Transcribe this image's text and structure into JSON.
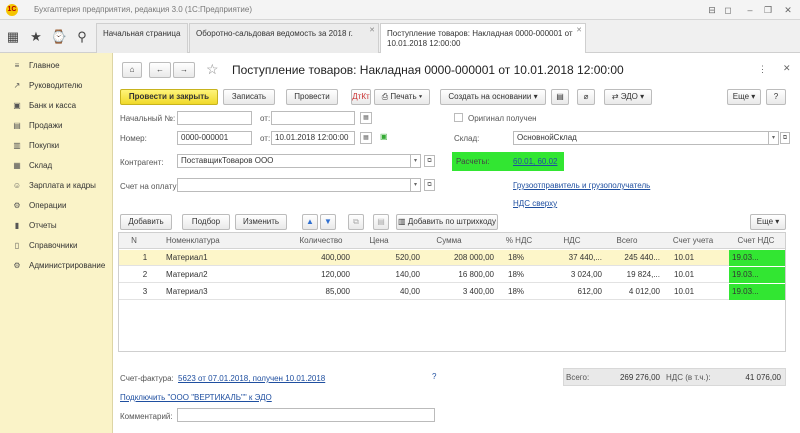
{
  "window": {
    "title": "Бухгалтерия предприятия, редакция 3.0 (1С:Предприятие)",
    "controls": [
      "⊟",
      "◻",
      "–",
      "❐",
      "✕"
    ]
  },
  "tabs": [
    {
      "label": "Начальная страница"
    },
    {
      "label": "Оборотно-сальдовая ведомость за 2018 г."
    },
    {
      "label": "Поступление товаров: Накладная 0000-000001 от 10.01.2018 12:00:00"
    }
  ],
  "sidebar": {
    "items": [
      {
        "icon": "≡",
        "label": "Главное"
      },
      {
        "icon": "↗",
        "label": "Руководителю"
      },
      {
        "icon": "▣",
        "label": "Банк и касса"
      },
      {
        "icon": "▤",
        "label": "Продажи"
      },
      {
        "icon": "▥",
        "label": "Покупки"
      },
      {
        "icon": "▦",
        "label": "Склад"
      },
      {
        "icon": "☺",
        "label": "Зарплата и кадры"
      },
      {
        "icon": "⚙",
        "label": "Операции"
      },
      {
        "icon": "▮",
        "label": "Отчеты"
      },
      {
        "icon": "▯",
        "label": "Справочники"
      },
      {
        "icon": "⚙",
        "label": "Администрирование"
      }
    ]
  },
  "doc": {
    "title": "Поступление товаров: Накладная 0000-000001 от 10.01.2018 12:00:00",
    "toolbar": {
      "post_close": "Провести и закрыть",
      "save": "Записать",
      "post": "Провести",
      "print": "Печать",
      "create_based": "Создать на основании",
      "edo": "ЭДО",
      "more": "Еще"
    },
    "fields": {
      "initial_no_label": "Начальный №:",
      "initial_no_value": "",
      "from_label": "от:",
      "number_label": "Номер:",
      "number_value": "0000-000001",
      "date_label": "от:",
      "date_value": "10.01.2018 12:00:00",
      "original_received": "Оригинал получен",
      "warehouse_label": "Склад:",
      "warehouse_value": "ОсновнойСклад",
      "counterparty_label": "Контрагент:",
      "counterparty_value": "ПоставщикТоваров ООО",
      "settlements_label": "Расчеты:",
      "settlements_value": "60.01, 60.02",
      "payment_invoice_label": "Счет на оплату:",
      "shipper_link": "Грузоотправитель и грузополучатель",
      "vat_link": "НДС сверху"
    },
    "table_toolbar": {
      "add": "Добавить",
      "pick": "Подбор",
      "change": "Изменить",
      "barcode": "Добавить по штрихкоду",
      "more": "Еще"
    },
    "table": {
      "headers": [
        "N",
        "Номенклатура",
        "Количество",
        "Цена",
        "Сумма",
        "% НДС",
        "НДС",
        "Всего",
        "Счет учета",
        "Счет НДС"
      ],
      "rows": [
        [
          "1",
          "Материал1",
          "400,000",
          "520,00",
          "208 000,00",
          "18%",
          "37 440,...",
          "245 440...",
          "10.01",
          "19.03..."
        ],
        [
          "2",
          "Материал2",
          "120,000",
          "140,00",
          "16 800,00",
          "18%",
          "3 024,00",
          "19 824,...",
          "10.01",
          "19.03..."
        ],
        [
          "3",
          "Материал3",
          "85,000",
          "40,00",
          "3 400,00",
          "18%",
          "612,00",
          "4 012,00",
          "10.01",
          "19.03..."
        ]
      ]
    },
    "footer": {
      "invoice_label": "Счет-фактура:",
      "invoice_link": "5623 от 07.01.2018, получен 10.01.2018",
      "help": "?",
      "connect_link": "Подключить \"ООО \"ВЕРТИКАЛЬ\"\" к ЭДО",
      "comment_label": "Комментарий:",
      "comment_value": "",
      "total_label": "Всего:",
      "total_value": "269 276,00",
      "vat_label": "НДС (в т.ч.):",
      "vat_value": "41 076,00"
    }
  },
  "colors": {
    "sidebar_bg": "#faf3c8",
    "primary_button": "#f0d92a",
    "highlight_green": "#32e632",
    "selected_row": "#fdf6c9",
    "link": "#1f4fa0"
  }
}
